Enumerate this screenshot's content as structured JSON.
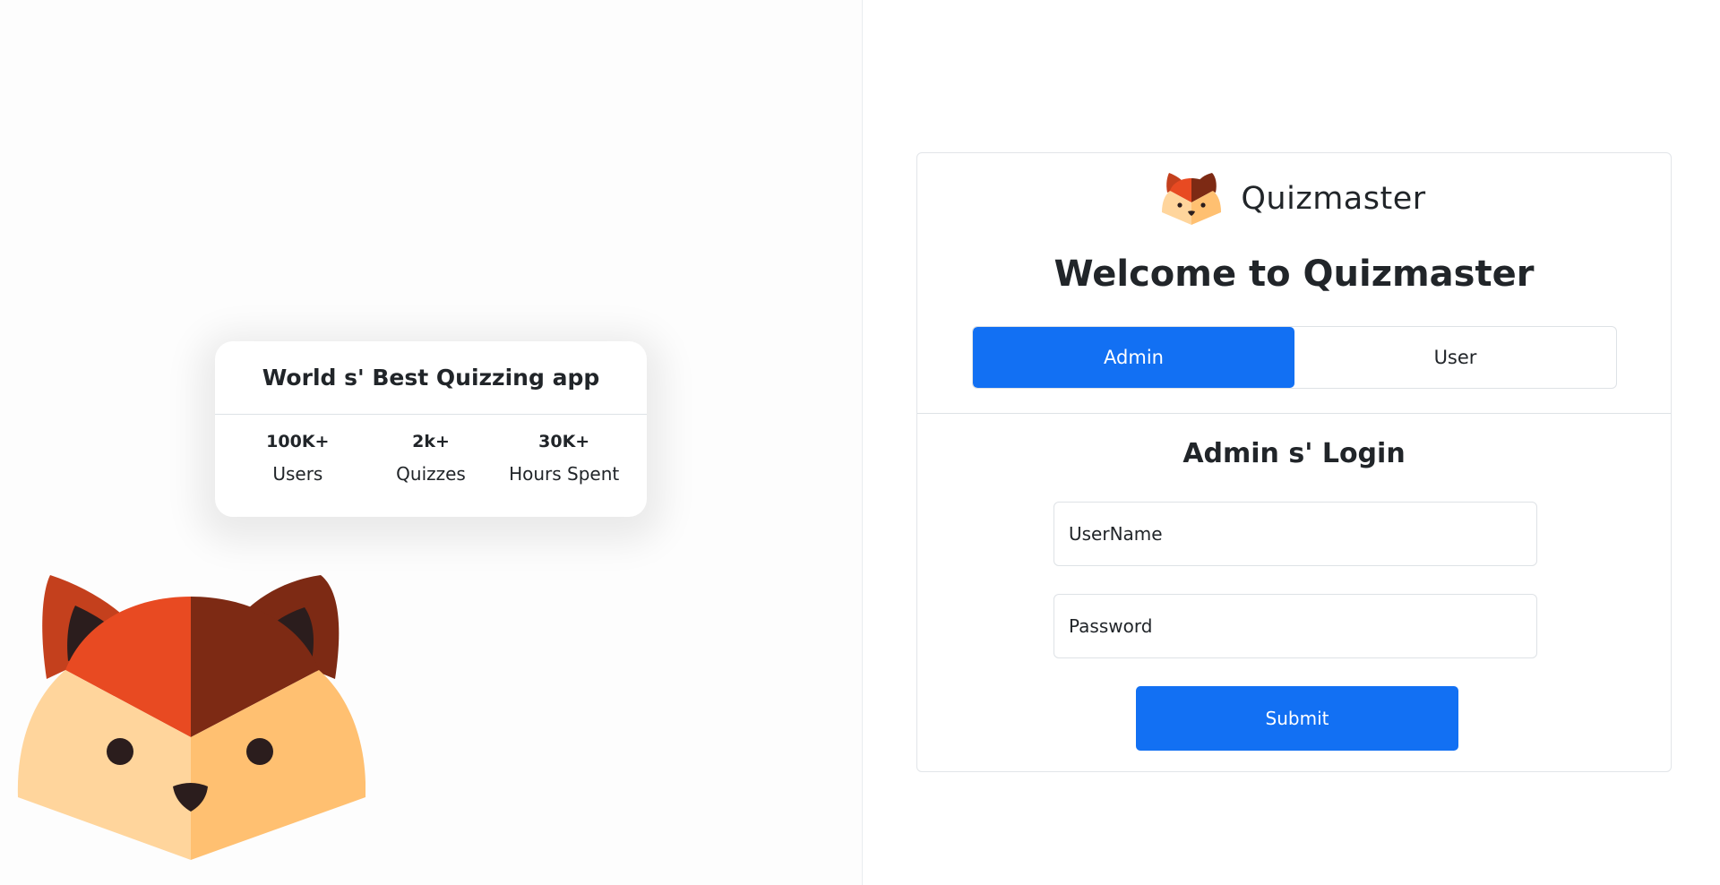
{
  "stats_card": {
    "title": "World s' Best Quizzing app",
    "stats": [
      {
        "value": "100K+",
        "label": "Users"
      },
      {
        "value": "2k+",
        "label": "Quizzes"
      },
      {
        "value": "30K+",
        "label": "Hours Spent"
      }
    ]
  },
  "brand": {
    "name": "Quizmaster",
    "logo_icon": "fox-logo-icon"
  },
  "login": {
    "welcome": "Welcome to Quizmaster",
    "tabs": [
      {
        "label": "Admin",
        "active": true
      },
      {
        "label": "User",
        "active": false
      }
    ],
    "title": "Admin s' Login",
    "username_placeholder": "UserName",
    "password_placeholder": "Password",
    "submit_label": "Submit"
  },
  "colors": {
    "primary": "#1270f3",
    "fox_dark": "#7d2a14",
    "fox_red": "#e84a22",
    "fox_light": "#ffd59c",
    "fox_mid": "#ffc071",
    "fox_ink": "#2b1d1d"
  }
}
